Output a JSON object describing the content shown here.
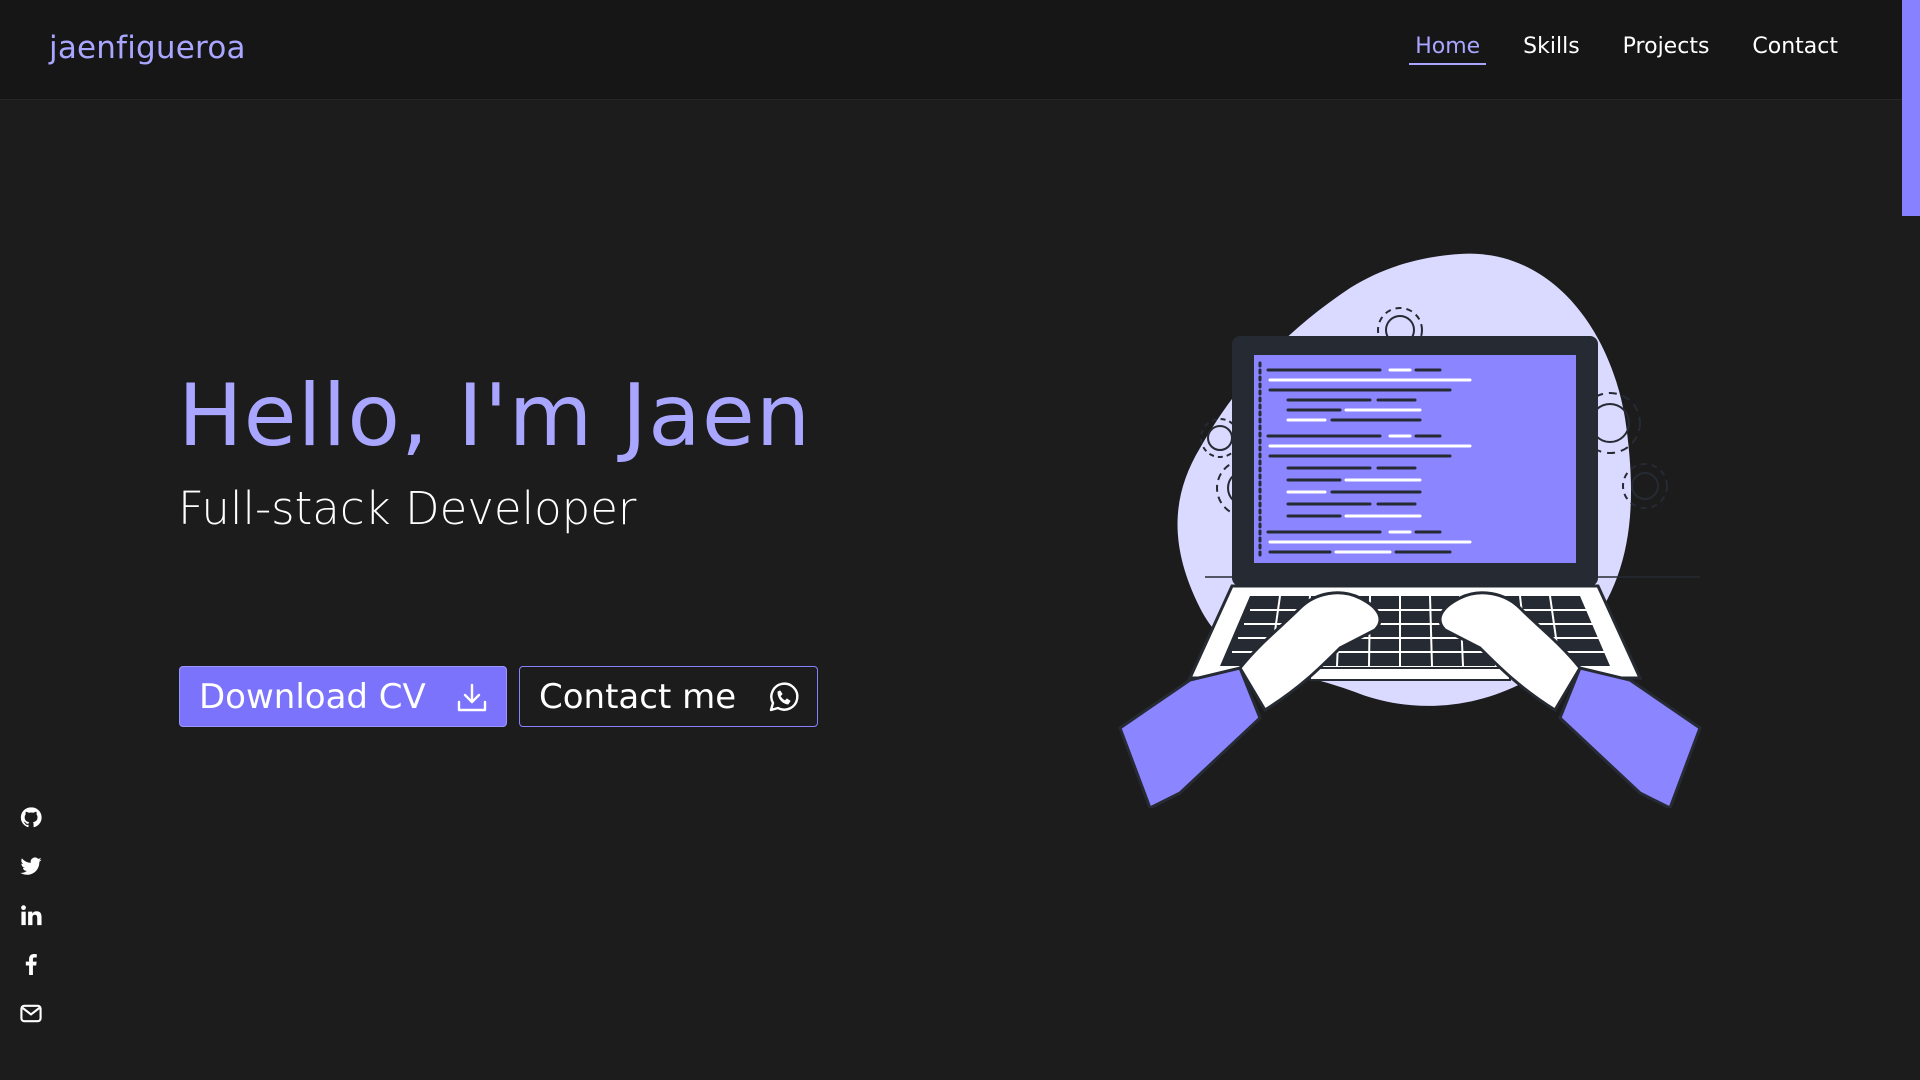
{
  "header": {
    "logo": "jaenfigueroa",
    "nav": [
      {
        "label": "Home",
        "active": true
      },
      {
        "label": "Skills"
      },
      {
        "label": "Projects"
      },
      {
        "label": "Contact"
      }
    ]
  },
  "hero": {
    "title": "Hello, I'm Jaen",
    "subtitle": "Full-stack Developer",
    "download_label": "Download CV",
    "contact_label": "Contact me"
  },
  "social": [
    {
      "icon": "github-icon"
    },
    {
      "icon": "twitter-icon"
    },
    {
      "icon": "linkedin-icon"
    },
    {
      "icon": "facebook-icon"
    },
    {
      "icon": "email-icon"
    }
  ],
  "colors": {
    "accent": "#a9a6ff",
    "button": "#7b73fb",
    "background": "#1c1c1d",
    "header": "#161617"
  }
}
